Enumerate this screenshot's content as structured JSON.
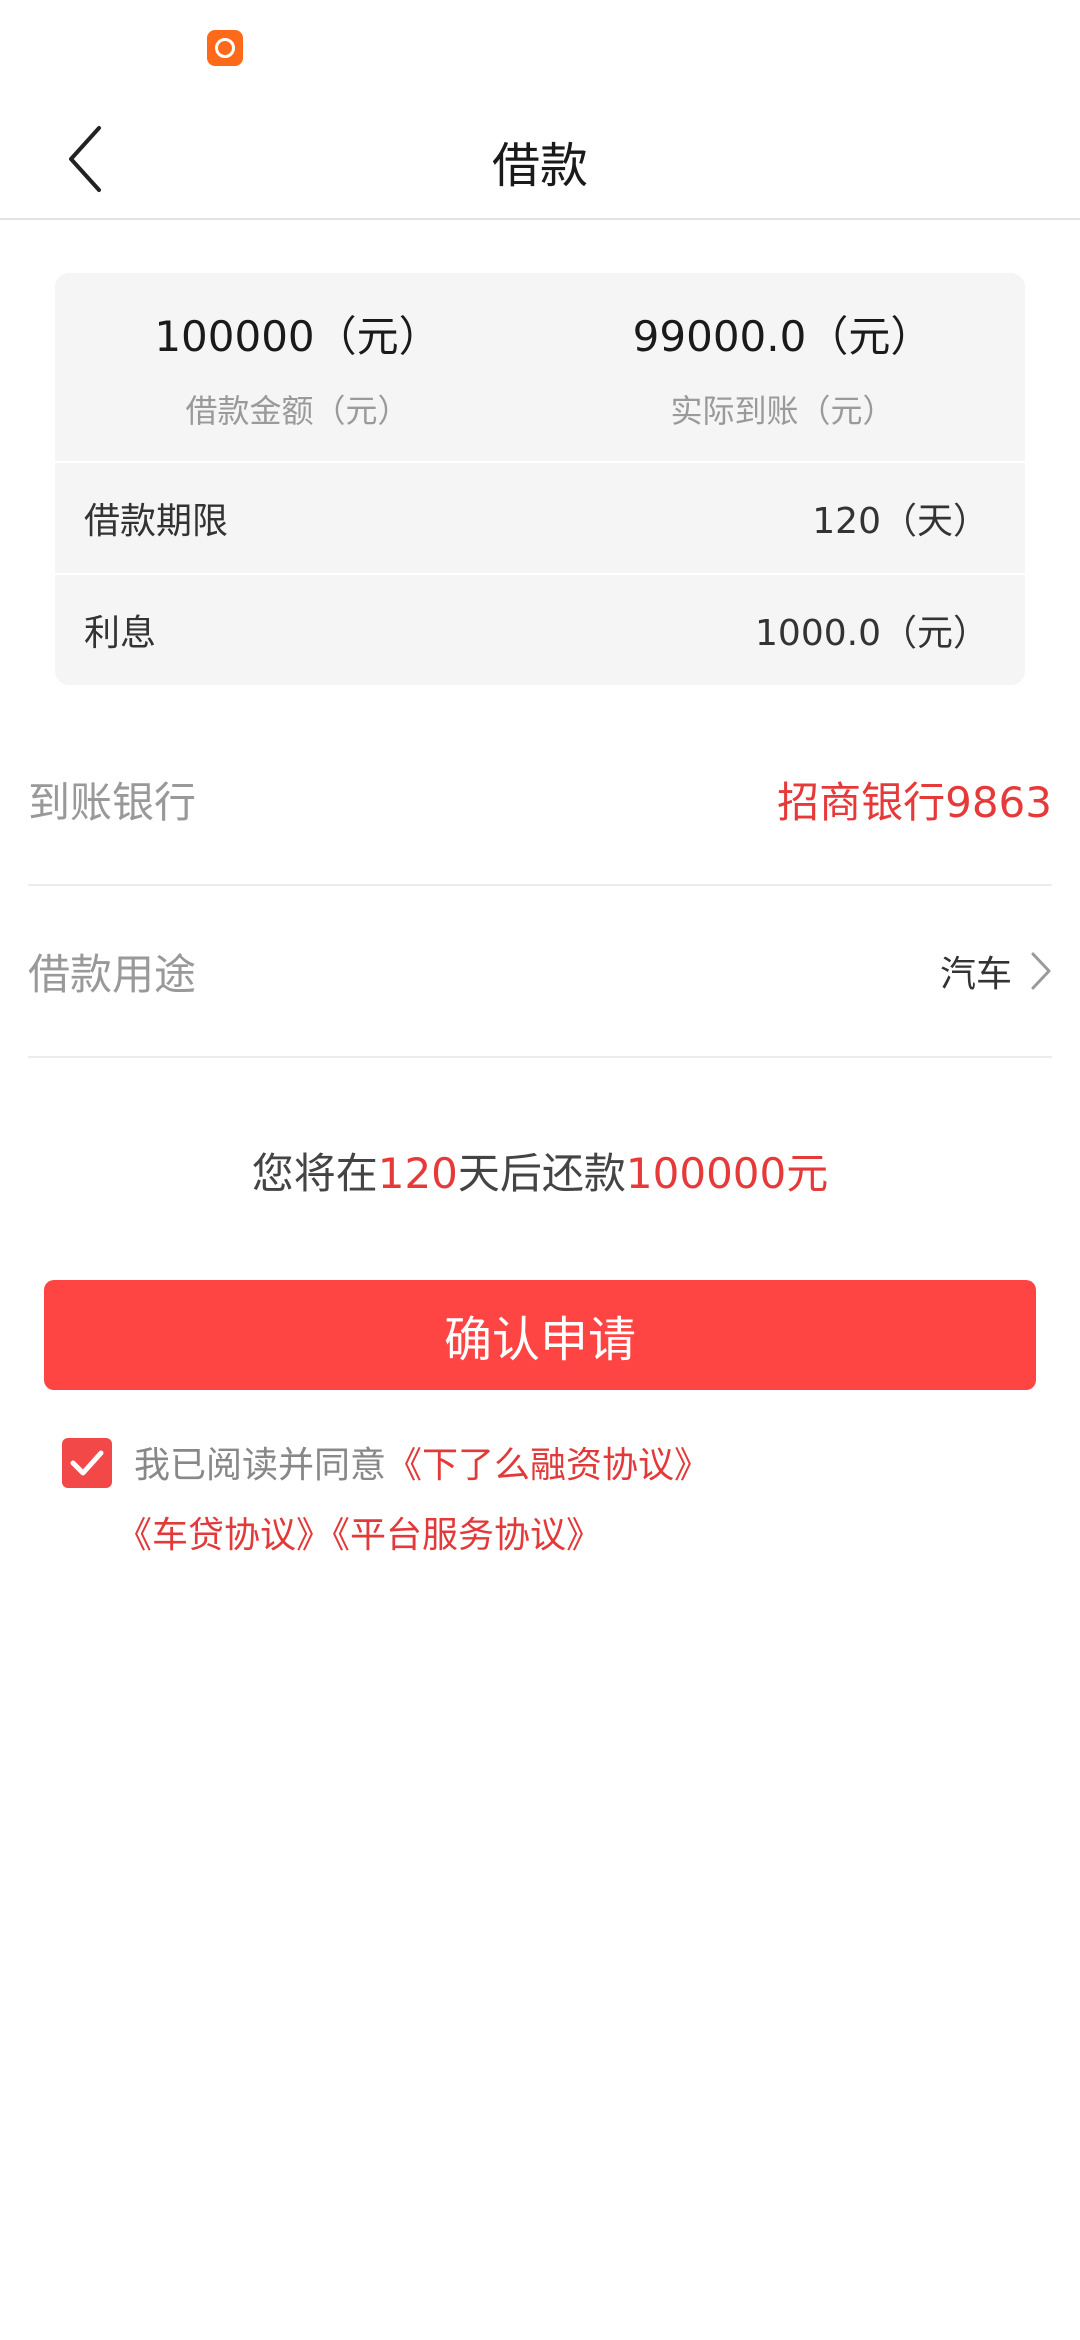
{
  "header": {
    "title": "借款"
  },
  "summary": {
    "amount_value": "100000（元）",
    "amount_label": "借款金额（元）",
    "received_value": "99000.0（元）",
    "received_label": "实际到账（元）",
    "rows": [
      {
        "label": "借款期限",
        "value": "120（天）"
      },
      {
        "label": "利息",
        "value": "1000.0（元）"
      }
    ]
  },
  "bank": {
    "label": "到账银行",
    "value": "招商银行9863"
  },
  "purpose": {
    "label": "借款用途",
    "value": "汽车"
  },
  "repayment": {
    "prefix": "您将在",
    "days": "120",
    "middle": "天后还款",
    "amount": "100000元"
  },
  "confirm_label": "确认申请",
  "agreement": {
    "checked": true,
    "text": "我已阅读并同意",
    "links": [
      "《下了么融资协议》",
      "《车贷协议》",
      "《平台服务协议》"
    ]
  },
  "colors": {
    "accent": "#ff4444",
    "highlight_text": "#e63a3a",
    "status_icon": "#ff6a1a"
  }
}
